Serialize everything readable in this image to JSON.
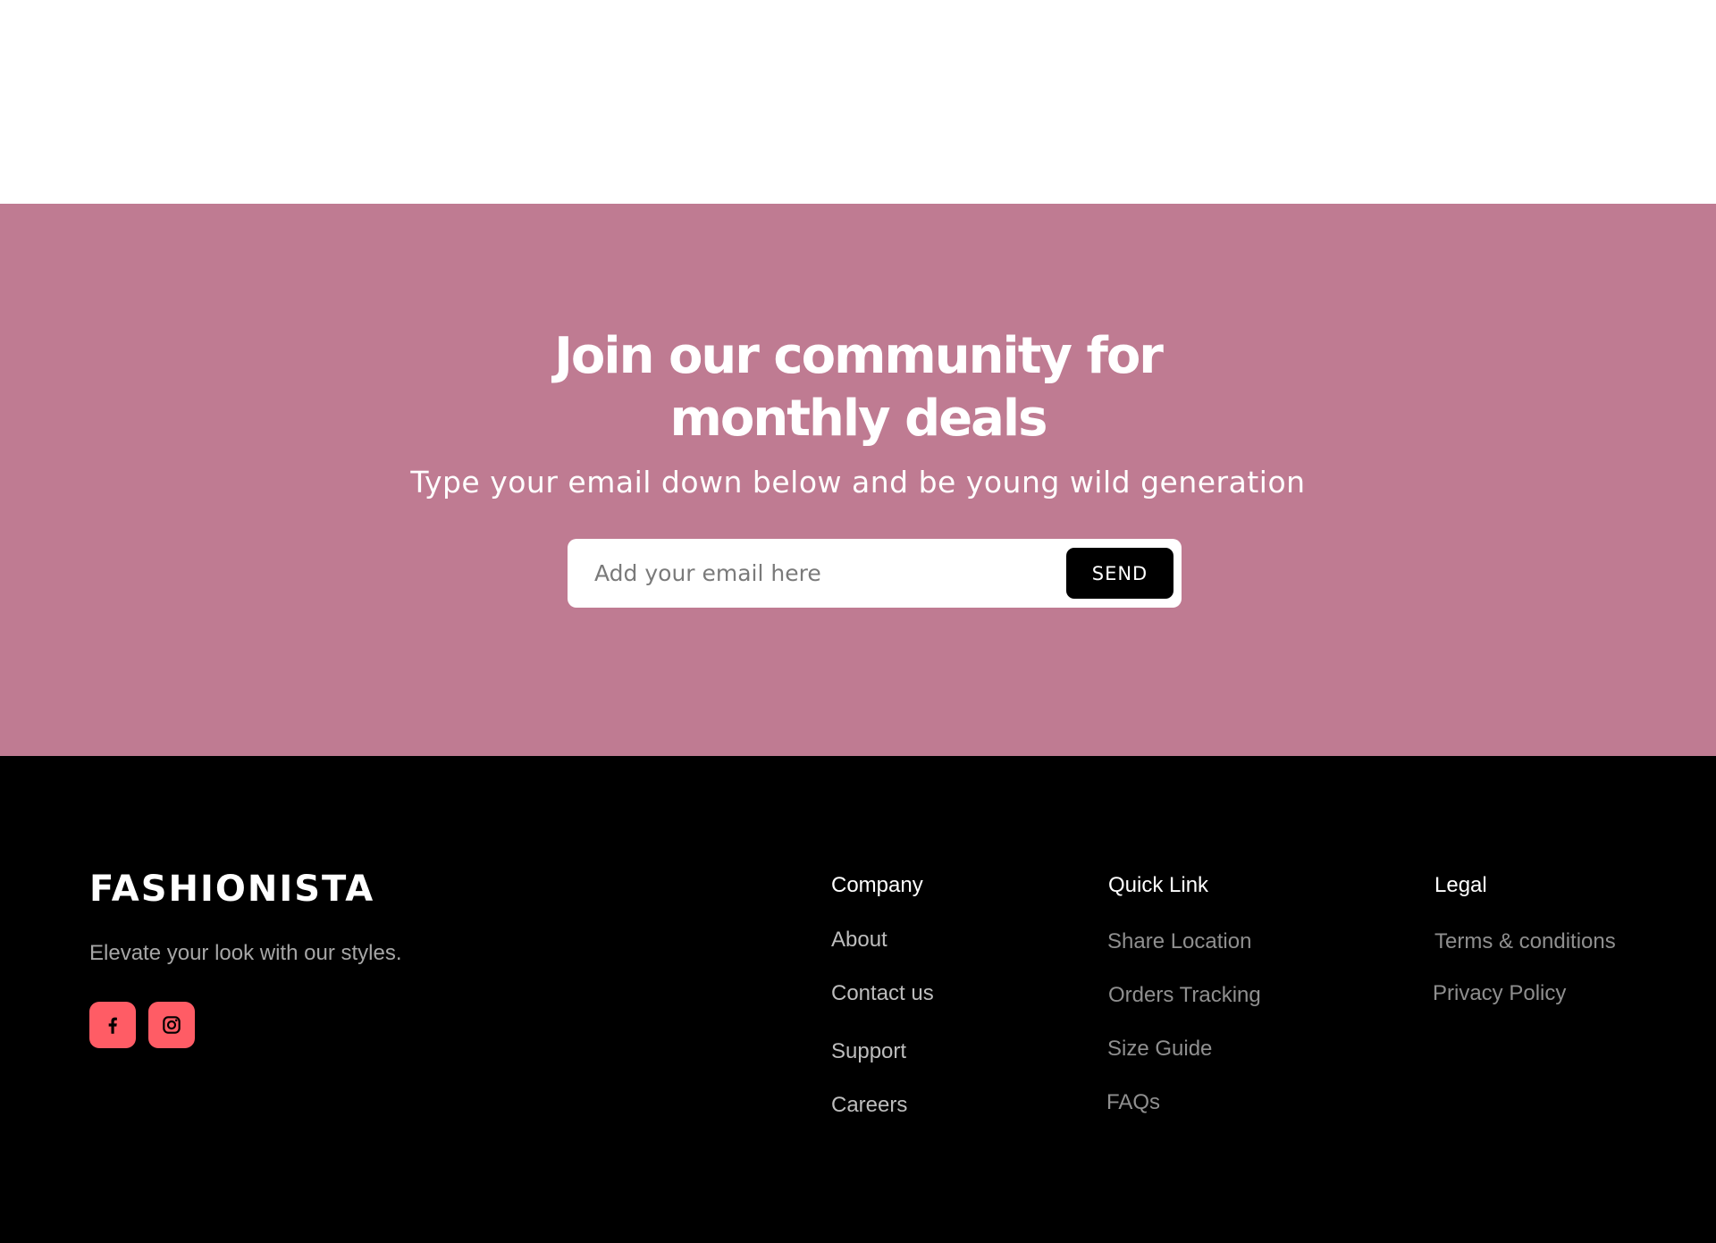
{
  "colors": {
    "newsletter_bg": "#bf7b92",
    "footer_bg": "#000000",
    "send_bg": "#000000",
    "social_bg": "#ff5c65"
  },
  "newsletter": {
    "title_line1": "Join our community for",
    "title_line2": "monthly deals",
    "subtitle": "Type your email down below and be young wild generation",
    "email_placeholder": "Add your email here",
    "send_label": "SEND"
  },
  "footer": {
    "brand": "FASHIONISTA",
    "tagline": "Elevate your look with our styles.",
    "social": [
      {
        "icon": "facebook-icon"
      },
      {
        "icon": "instagram-icon"
      }
    ],
    "columns": {
      "company": {
        "heading": "Company",
        "links": [
          "About",
          "Contact us",
          "Support",
          "Careers"
        ]
      },
      "quick": {
        "heading": "Quick Link",
        "links": [
          "Share Location",
          "Orders Tracking",
          "Size Guide",
          "FAQs"
        ]
      },
      "legal": {
        "heading": "Legal",
        "links": [
          "Terms & conditions",
          "Privacy Policy"
        ]
      }
    }
  }
}
